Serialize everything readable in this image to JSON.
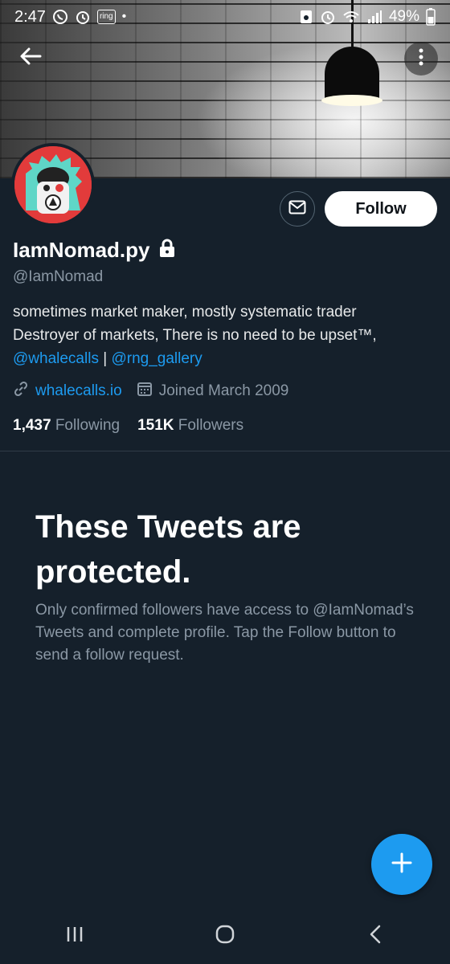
{
  "status_bar": {
    "time": "2:47",
    "ring_badge": "ring",
    "dot": "•",
    "battery_percent": "49%",
    "left_icons": [
      "whatsapp-icon",
      "alarm-icon",
      "ring-icon"
    ],
    "right_icons": [
      "screenshot-icon",
      "alarm-icon",
      "wifi-icon",
      "signal-icon",
      "battery-icon"
    ]
  },
  "header": {
    "back_icon": "arrow-left-icon",
    "more_icon": "more-vertical-icon"
  },
  "profile": {
    "display_name": "IamNomad.py",
    "handle": "@IamNomad",
    "bio_line1": "sometimes market maker, mostly systematic trader",
    "bio_line2": "Destroyer of markets, There is no need to be upset™,",
    "bio_link1": "@whalecalls",
    "bio_separator": " | ",
    "bio_link2": "@rng_gallery",
    "website": "whalecalls.io",
    "joined": "Joined March 2009",
    "following_count": "1,437",
    "following_label": "Following",
    "followers_count": "151K",
    "followers_label": "Followers"
  },
  "actions": {
    "follow_label": "Follow",
    "message_icon": "envelope-icon"
  },
  "protected": {
    "title": "These Tweets are protected.",
    "description": "Only confirmed followers have access to @IamNomad’s Tweets and complete profile. Tap the Follow button to send a follow request."
  },
  "fab": {
    "icon": "plus-icon"
  },
  "nav_bar": {
    "items": [
      "recents-icon",
      "home-icon",
      "back-icon"
    ]
  },
  "colors": {
    "background": "#15202b",
    "accent": "#1d9bf0",
    "secondary_text": "#8b98a5"
  }
}
